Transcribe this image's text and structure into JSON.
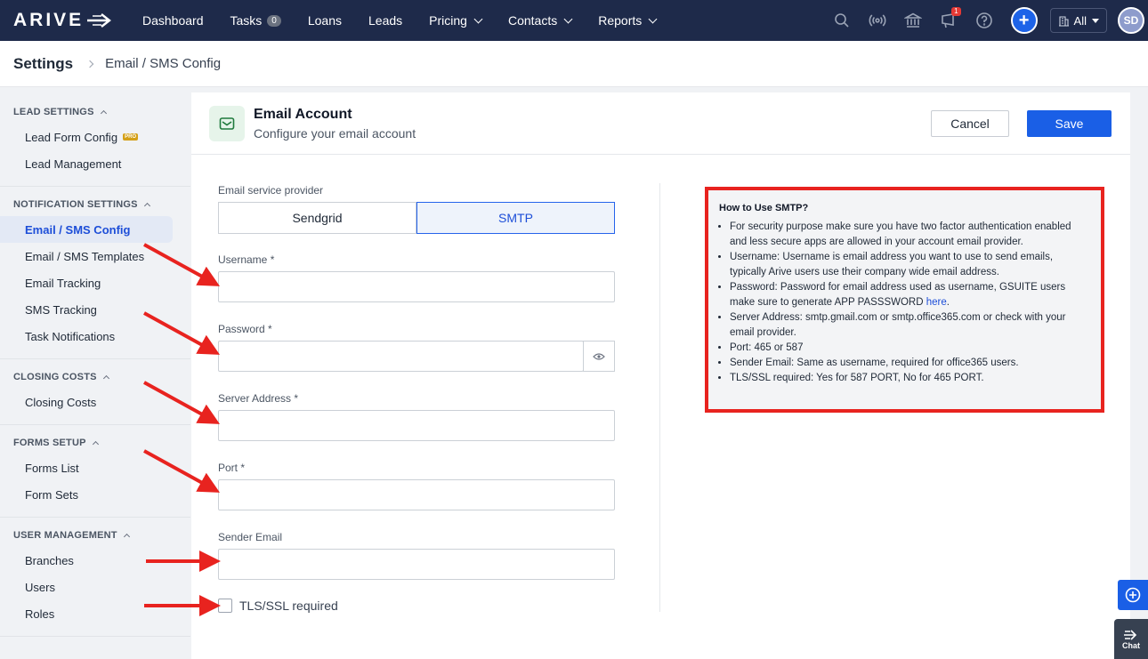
{
  "brand": {
    "logo": "ARIVE"
  },
  "nav": {
    "items": [
      {
        "label": "Dashboard"
      },
      {
        "label": "Tasks",
        "badge": "0"
      },
      {
        "label": "Loans"
      },
      {
        "label": "Leads"
      },
      {
        "label": "Pricing",
        "dropdown": true
      },
      {
        "label": "Contacts",
        "dropdown": true
      },
      {
        "label": "Reports",
        "dropdown": true
      }
    ],
    "notification_count": "1",
    "company_select": "All",
    "avatar_initials": "SD",
    "icons": [
      "search-icon",
      "broadcast-icon",
      "bank-icon",
      "announcement-icon",
      "help-icon",
      "plus-icon"
    ]
  },
  "breadcrumb": {
    "title": "Settings",
    "page": "Email / SMS Config"
  },
  "sidebar": {
    "sections": [
      {
        "title": "LEAD SETTINGS",
        "items": [
          {
            "label": "Lead Form Config",
            "pro": "PRO"
          },
          {
            "label": "Lead Management"
          }
        ]
      },
      {
        "title": "NOTIFICATION SETTINGS",
        "items": [
          {
            "label": "Email / SMS Config",
            "active": true
          },
          {
            "label": "Email / SMS Templates"
          },
          {
            "label": "Email Tracking"
          },
          {
            "label": "SMS Tracking"
          },
          {
            "label": "Task Notifications"
          }
        ]
      },
      {
        "title": "CLOSING COSTS",
        "items": [
          {
            "label": "Closing Costs"
          }
        ]
      },
      {
        "title": "FORMS SETUP",
        "items": [
          {
            "label": "Forms List"
          },
          {
            "label": "Form Sets"
          }
        ]
      },
      {
        "title": "USER MANAGEMENT",
        "items": [
          {
            "label": "Branches"
          },
          {
            "label": "Users"
          },
          {
            "label": "Roles"
          }
        ]
      }
    ]
  },
  "card": {
    "title": "Email Account",
    "subtitle": "Configure your email account",
    "cancel_label": "Cancel",
    "save_label": "Save"
  },
  "form": {
    "provider_label": "Email service provider",
    "providers": [
      "Sendgrid",
      "SMTP"
    ],
    "selected_provider": "SMTP",
    "username_label": "Username *",
    "username_value": "",
    "password_label": "Password *",
    "password_value": "",
    "server_label": "Server Address *",
    "server_value": "",
    "port_label": "Port *",
    "port_value": "",
    "sender_label": "Sender Email",
    "sender_value": "",
    "tls_label": "TLS/SSL required",
    "tls_checked": false
  },
  "help": {
    "title": "How to Use SMTP?",
    "items": [
      "For security purpose make sure you have two factor authentication enabled and less secure apps are allowed in your account email provider.",
      "Username: Username is email address you want to use to send emails, typically Arive users use their company wide email address.",
      "Password: Password for email address used as username, GSUITE users make sure to generate APP PASSSWORD",
      "Server Address: smtp.gmail.com or smtp.office365.com or check with your email provider.",
      "Port: 465 or 587",
      "Sender Email: Same as username, required for office365 users.",
      "TLS/SSL required: Yes for 587 PORT, No for 465 PORT."
    ],
    "link_text": "here"
  },
  "floating": {
    "chat_label": "Chat"
  },
  "colors": {
    "nav_bg": "#1e2a4a",
    "primary": "#1a5fe6",
    "annotation": "#e8231f"
  }
}
